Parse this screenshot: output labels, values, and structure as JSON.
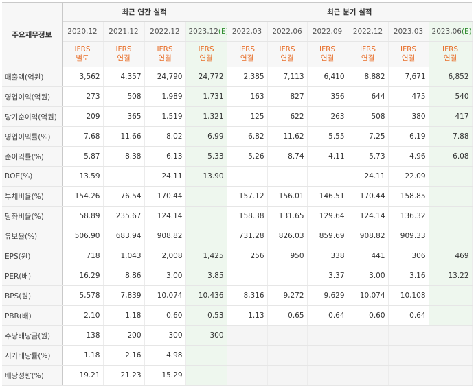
{
  "corner_label": "주요재무정보",
  "annual_title": "최근 연간 실적",
  "quarter_title": "최근 분기 실적",
  "periods": [
    {
      "label": "2020,12",
      "std": "IFRS",
      "basis": "별도",
      "est": false
    },
    {
      "label": "2021,12",
      "std": "IFRS",
      "basis": "연결",
      "est": false
    },
    {
      "label": "2022,12",
      "std": "IFRS",
      "basis": "연결",
      "est": false
    },
    {
      "label": "2023,12",
      "est_mark": "(E)",
      "std": "IFRS",
      "basis": "연결",
      "est": true
    },
    {
      "label": "2022,03",
      "std": "IFRS",
      "basis": "연결",
      "est": false
    },
    {
      "label": "2022,06",
      "std": "IFRS",
      "basis": "연결",
      "est": false
    },
    {
      "label": "2022,09",
      "std": "IFRS",
      "basis": "연결",
      "est": false
    },
    {
      "label": "2022,12",
      "std": "IFRS",
      "basis": "연결",
      "est": false
    },
    {
      "label": "2023,03",
      "std": "IFRS",
      "basis": "연결",
      "est": false
    },
    {
      "label": "2023,06",
      "est_mark": "(E)",
      "std": "IFRS",
      "basis": "연결",
      "est": true
    }
  ],
  "rows": [
    {
      "label": "매출액(억원)",
      "values": [
        "3,562",
        "4,357",
        "24,790",
        "24,772",
        "2,385",
        "7,113",
        "6,410",
        "8,882",
        "7,671",
        "6,852"
      ]
    },
    {
      "label": "영업이익(억원)",
      "values": [
        "273",
        "508",
        "1,989",
        "1,731",
        "163",
        "827",
        "356",
        "644",
        "475",
        "540"
      ]
    },
    {
      "label": "당기순이익(억원)",
      "values": [
        "209",
        "365",
        "1,519",
        "1,321",
        "125",
        "622",
        "263",
        "508",
        "380",
        "417"
      ]
    },
    {
      "label": "영업이익률(%)",
      "values": [
        "7.68",
        "11.66",
        "8.02",
        "6.99",
        "6.82",
        "11.62",
        "5.55",
        "7.25",
        "6.19",
        "7.88"
      ]
    },
    {
      "label": "순이익률(%)",
      "values": [
        "5.87",
        "8.38",
        "6.13",
        "5.33",
        "5.26",
        "8.74",
        "4.11",
        "5.73",
        "4.96",
        "6.08"
      ]
    },
    {
      "label": "ROE(%)",
      "values": [
        "13.59",
        "",
        "24.11",
        "13.90",
        "",
        "",
        "",
        "24.11",
        "22.09",
        ""
      ]
    },
    {
      "label": "부채비율(%)",
      "values": [
        "154.26",
        "76.54",
        "170.44",
        "",
        "157.12",
        "156.01",
        "146.51",
        "170.44",
        "158.85",
        ""
      ]
    },
    {
      "label": "당좌비율(%)",
      "values": [
        "58.89",
        "235.67",
        "124.14",
        "",
        "158.38",
        "131.65",
        "129.64",
        "124.14",
        "136.32",
        ""
      ]
    },
    {
      "label": "유보율(%)",
      "values": [
        "506.90",
        "683.94",
        "908.82",
        "",
        "731.28",
        "826.03",
        "859.69",
        "908.82",
        "909.33",
        ""
      ]
    },
    {
      "label": "EPS(원)",
      "values": [
        "718",
        "1,043",
        "2,008",
        "1,425",
        "256",
        "950",
        "338",
        "441",
        "306",
        "469"
      ]
    },
    {
      "label": "PER(배)",
      "values": [
        "16.29",
        "8.86",
        "3.00",
        "3.85",
        "",
        "",
        "3.37",
        "3.00",
        "3.16",
        "13.22"
      ]
    },
    {
      "label": "BPS(원)",
      "values": [
        "5,578",
        "7,839",
        "10,074",
        "10,436",
        "8,316",
        "9,272",
        "9,629",
        "10,074",
        "10,108",
        ""
      ]
    },
    {
      "label": "PBR(배)",
      "values": [
        "2.10",
        "1.18",
        "0.60",
        "0.53",
        "1.13",
        "0.65",
        "0.64",
        "0.60",
        "0.64",
        ""
      ]
    },
    {
      "label": "주당배당금(원)",
      "values": [
        "138",
        "200",
        "300",
        "300",
        "",
        "",
        "",
        "",
        "",
        ""
      ]
    },
    {
      "label": "시가배당률(%)",
      "values": [
        "1.18",
        "2.16",
        "4.98",
        "",
        "",
        "",
        "",
        "",
        "",
        ""
      ]
    },
    {
      "label": "배당성향(%)",
      "values": [
        "19.21",
        "21.23",
        "15.29",
        "",
        "",
        "",
        "",
        "",
        "",
        ""
      ]
    }
  ]
}
